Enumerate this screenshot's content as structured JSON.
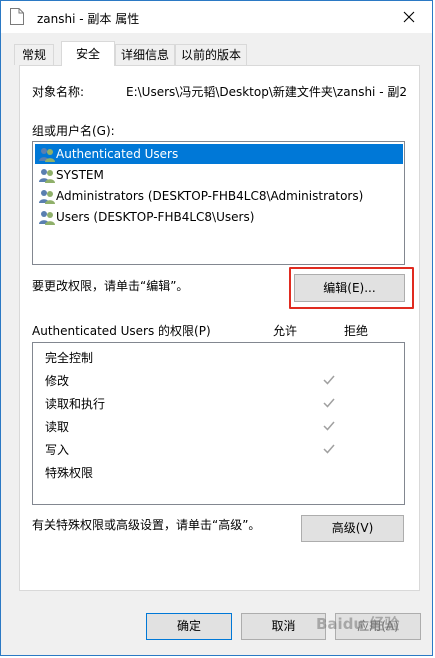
{
  "window": {
    "title": "zanshi - 副本 属性",
    "colors": {
      "frame": "#2b79c4",
      "selection": "#0078d7",
      "highlight": "#e02b20"
    }
  },
  "tabs": [
    {
      "label": "常规",
      "active": false
    },
    {
      "label": "安全",
      "active": true
    },
    {
      "label": "详细信息",
      "active": false
    },
    {
      "label": "以前的版本",
      "active": false
    }
  ],
  "security": {
    "object_name_label": "对象名称:",
    "object_name_value": "E:\\Users\\冯元韬\\Desktop\\新建文件夹\\zanshi - 副2",
    "group_label": "组或用户名(G):",
    "users": [
      {
        "name": "Authenticated Users",
        "icon": "users-group-icon",
        "selected": true
      },
      {
        "name": "SYSTEM",
        "icon": "users-group-icon",
        "selected": false
      },
      {
        "name": "Administrators (DESKTOP-FHB4LC8\\Administrators)",
        "icon": "users-group-icon",
        "selected": false
      },
      {
        "name": "Users (DESKTOP-FHB4LC8\\Users)",
        "icon": "users-group-icon",
        "selected": false
      }
    ],
    "change_hint": "要更改权限，请单击“编辑”。",
    "edit_button": "编辑(E)...",
    "perm_header": "Authenticated Users 的权限(P)",
    "allow_header": "允许",
    "deny_header": "拒绝",
    "permissions": [
      {
        "name": "完全控制",
        "allow": false
      },
      {
        "name": "修改",
        "allow": true
      },
      {
        "name": "读取和执行",
        "allow": true
      },
      {
        "name": "读取",
        "allow": true
      },
      {
        "name": "写入",
        "allow": true
      },
      {
        "name": "特殊权限",
        "allow": false
      }
    ],
    "advanced_hint": "有关特殊权限或高级设置，请单击“高级”。",
    "advanced_button": "高级(V)"
  },
  "footer": {
    "ok": "确定",
    "cancel": "取消",
    "apply": "应用(A)"
  },
  "watermark": "Baidu 经验"
}
